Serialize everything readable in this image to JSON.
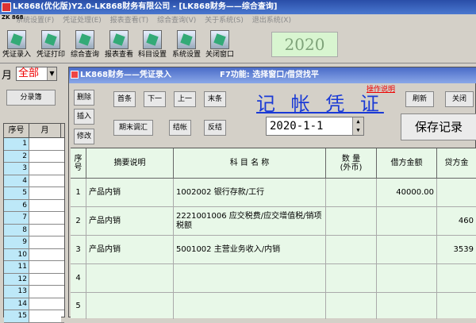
{
  "main_window": {
    "title": "LK868(优化版)Y2.0-LK868财务有限公司 - [LK868财务——综合查询]"
  },
  "menu": {
    "logo": "ZK 868",
    "items": [
      "系统设置(F)",
      "凭证处理(E)",
      "报表查看(T)",
      "综合查询(V)",
      "关于系统(S)",
      "退出系统(X)"
    ]
  },
  "toolbar": {
    "buttons": [
      {
        "label": "凭证录入",
        "icon": "voucher-entry-icon"
      },
      {
        "label": "凭证打印",
        "icon": "print-icon"
      },
      {
        "label": "综合查询",
        "icon": "query-icon"
      },
      {
        "label": "报表查看",
        "icon": "report-icon"
      },
      {
        "label": "科目设置",
        "icon": "account-settings-icon"
      },
      {
        "label": "系统设置",
        "icon": "system-settings-icon"
      },
      {
        "label": "关闭窗口",
        "icon": "close-window-icon"
      }
    ],
    "year": "2020"
  },
  "left_pane": {
    "month_label": "月",
    "month_value": "全部",
    "ledger_button": "分录簿",
    "grid_headers": [
      "序号",
      "月"
    ],
    "row_numbers": [
      "1",
      "2",
      "3",
      "4",
      "5",
      "6",
      "7",
      "8",
      "9",
      "10",
      "11",
      "12",
      "13",
      "14",
      "15"
    ]
  },
  "voucher_window": {
    "title": "LK868财务——凭证录入",
    "f7_hint": "F7功能: 选择窗口/借贷找平",
    "buttons": {
      "delete": "删除",
      "insert": "插入",
      "modify": "修改",
      "first": "首条",
      "next": "下一",
      "prev": "上一",
      "last": "末条",
      "period_adjust": "期末调汇",
      "close_account": "结帐",
      "reverse_close": "反结",
      "refresh": "刷新",
      "close": "关闭"
    },
    "heading": "记 帐 凭 证",
    "op_guide": "操作说明",
    "date": "2020-1-1",
    "save_label": "保存记录",
    "table": {
      "headers": {
        "seq": "序号",
        "summary": "摘要说明",
        "account": "科 目 名 称",
        "qty": "数 量\n(外币)",
        "debit": "借方金额",
        "credit": "贷方金"
      },
      "rows": [
        {
          "seq": "1",
          "summary": "产品内销",
          "account": "1002002 银行存款/工行",
          "debit": "40000.00",
          "credit": ""
        },
        {
          "seq": "2",
          "summary": "产品内销",
          "account": "2221001006 应交税费/应交增值税/销项税额",
          "debit": "",
          "credit": "460"
        },
        {
          "seq": "3",
          "summary": "产品内销",
          "account": "5001002 主营业务收入/内销",
          "debit": "",
          "credit": "3539"
        },
        {
          "seq": "4",
          "summary": "",
          "account": "",
          "debit": "",
          "credit": ""
        },
        {
          "seq": "5",
          "summary": "",
          "account": "",
          "debit": "",
          "credit": ""
        }
      ]
    }
  }
}
